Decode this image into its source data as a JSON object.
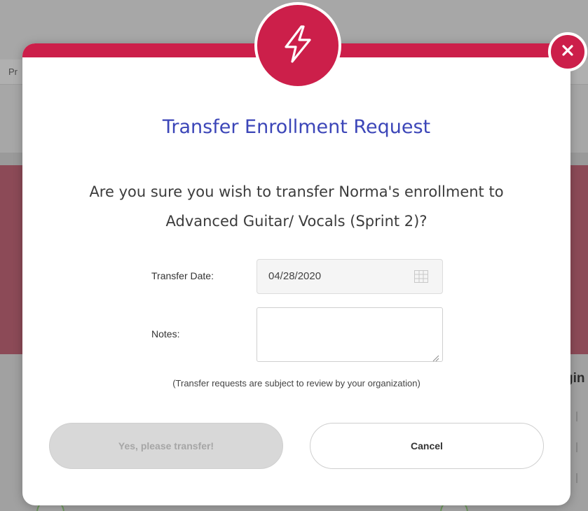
{
  "background": {
    "tab_fragment": "Pr",
    "side_text_fragment": "gin"
  },
  "modal": {
    "badge_icon": "lightning-bolt-icon",
    "close_icon": "close-icon",
    "title": "Transfer Enrollment Request",
    "question_line1": "Are you sure you wish to transfer Norma's enrollment to",
    "question_line2": "Advanced Guitar/ Vocals (Sprint 2)?",
    "transfer_date_label": "Transfer Date:",
    "transfer_date_value": "04/28/2020",
    "notes_label": "Notes:",
    "notes_value": "",
    "disclaimer": "(Transfer requests are subject to review by your organization)",
    "confirm_label": "Yes, please transfer!",
    "cancel_label": "Cancel"
  },
  "colors": {
    "accent": "#cc1f4a",
    "title": "#3c46b8",
    "disabled_button": "#d8d8d8"
  }
}
